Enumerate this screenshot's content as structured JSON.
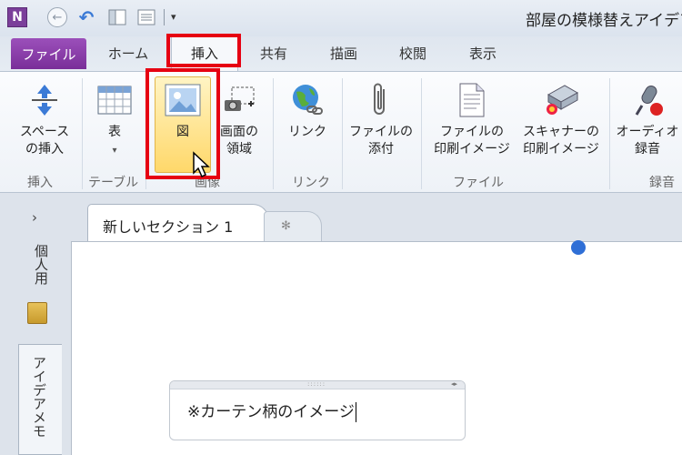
{
  "window": {
    "title": "部屋の模様替えアイデア"
  },
  "quick_access": {
    "app_icon_letter": "N",
    "more": "▾"
  },
  "ribbon_tabs": {
    "file": "ファイル",
    "home": "ホーム",
    "insert": "挿入",
    "share": "共有",
    "draw": "描画",
    "review": "校閲",
    "view": "表示"
  },
  "ribbon": {
    "insert_space": {
      "line1": "スペース",
      "line2": "の挿入"
    },
    "table": {
      "line1": "表",
      "line2": "▾"
    },
    "picture": {
      "label": "図"
    },
    "screen_clipping": {
      "line1": "画面の",
      "line2": "領域"
    },
    "link": {
      "label": "リンク"
    },
    "attach_file": {
      "line1": "ファイルの",
      "line2": "添付"
    },
    "file_printout": {
      "line1": "ファイルの",
      "line2": "印刷イメージ"
    },
    "scanner_printout": {
      "line1": "スキャナーの",
      "line2": "印刷イメージ"
    },
    "audio": {
      "line1": "オーディオ",
      "line2": "録音"
    },
    "groups": {
      "insert": "挿入",
      "tables": "テーブル",
      "images": "画像",
      "links": "リンク",
      "files": "ファイル",
      "recording": "録音"
    }
  },
  "notebook": {
    "nav_arrow": "›",
    "section_tab": "新しいセクション 1",
    "new_section_tab": "✻",
    "sidebar_notebook_name": "個人用",
    "sidebar_tab": "アイデアメモ"
  },
  "note": {
    "text": "※カーテン柄のイメージ",
    "dots": "::::::",
    "resize": "◂▸"
  },
  "colors": {
    "highlight": "#e60012",
    "file_tab": "#8a3fac",
    "accent": "#2f6fd6"
  }
}
